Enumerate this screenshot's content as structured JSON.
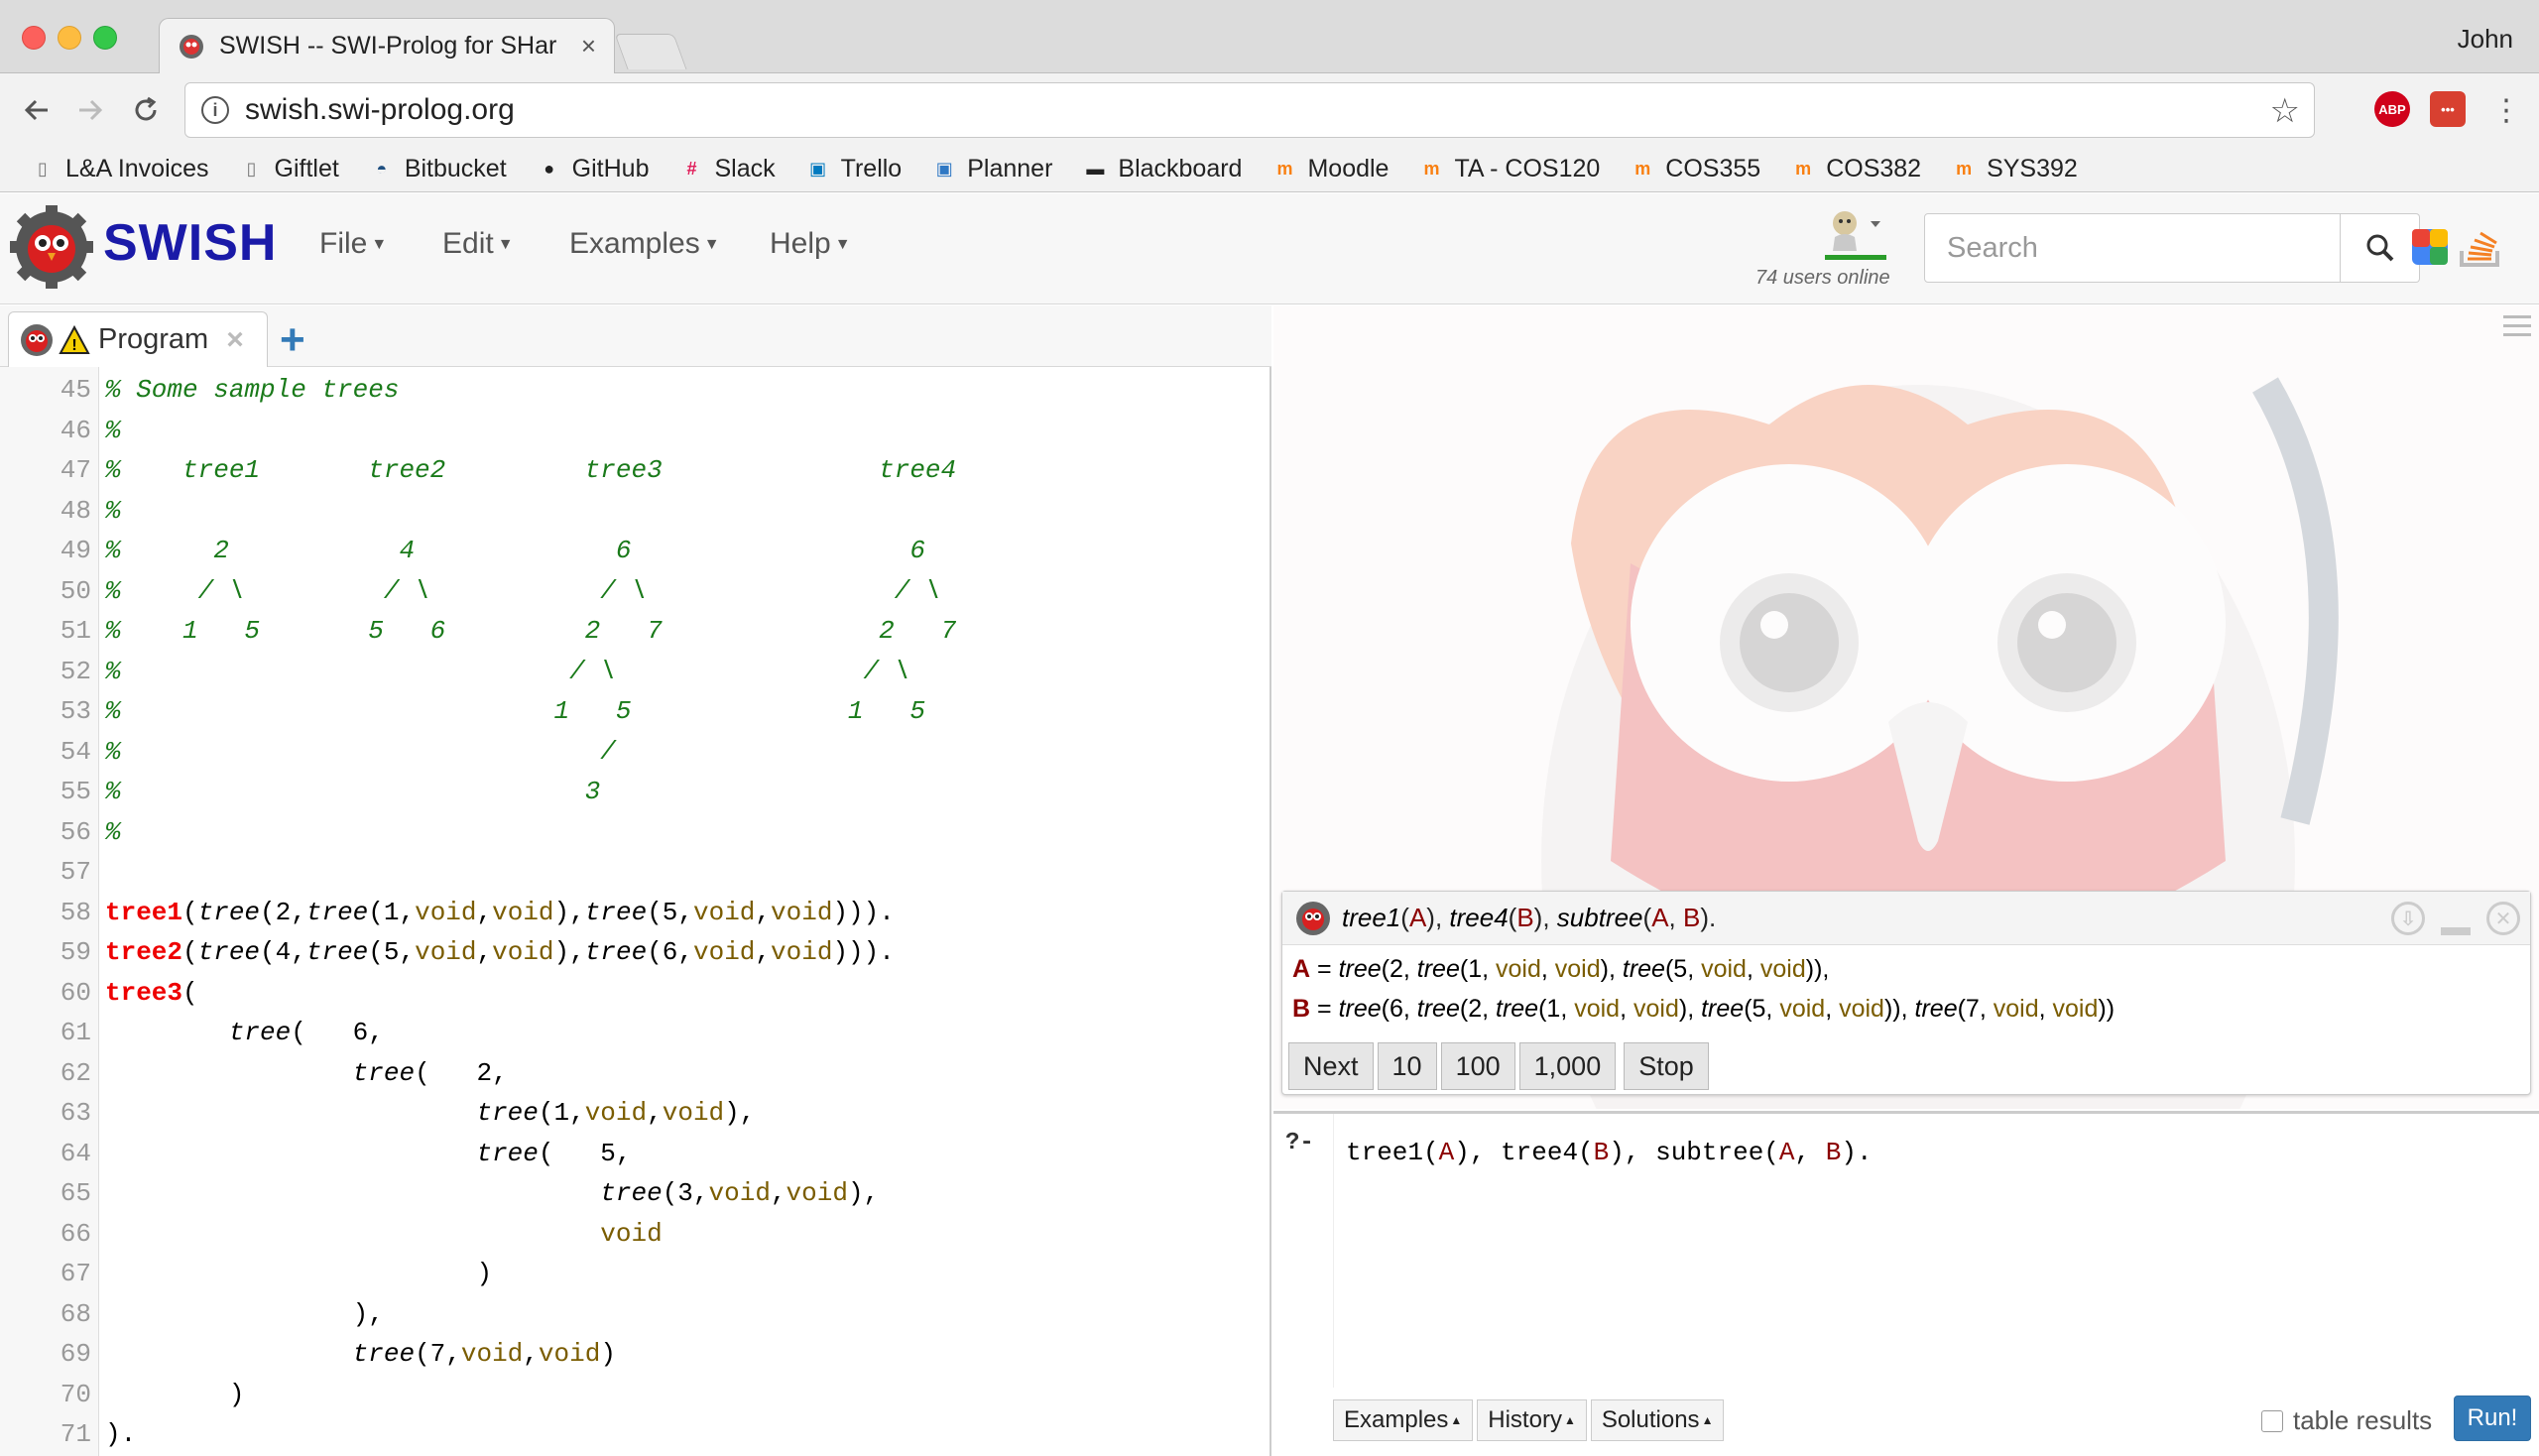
{
  "browser": {
    "tab_title": "SWISH -- SWI-Prolog for SHar",
    "tab_close": "×",
    "profile": "John",
    "url": "swish.swi-prolog.org",
    "ext1_label": "ABP",
    "ext2_label": "•••",
    "colors": {
      "close": "#fc605c",
      "minimize": "#fdbc40",
      "maximize": "#34c84a"
    }
  },
  "bookmarks": [
    {
      "label": "L&A Invoices",
      "icon": "page-icon"
    },
    {
      "label": "Giftlet",
      "icon": "page-icon"
    },
    {
      "label": "Bitbucket",
      "icon": "bitbucket-icon"
    },
    {
      "label": "GitHub",
      "icon": "github-icon"
    },
    {
      "label": "Slack",
      "icon": "slack-icon"
    },
    {
      "label": "Trello",
      "icon": "trello-icon"
    },
    {
      "label": "Planner",
      "icon": "planner-icon"
    },
    {
      "label": "Blackboard",
      "icon": "blackboard-icon"
    },
    {
      "label": "Moodle",
      "icon": "moodle-icon"
    },
    {
      "label": "TA -  COS120",
      "icon": "moodle-icon"
    },
    {
      "label": "COS355",
      "icon": "moodle-icon"
    },
    {
      "label": "COS382",
      "icon": "moodle-icon"
    },
    {
      "label": "SYS392",
      "icon": "moodle-icon"
    }
  ],
  "header": {
    "brand": "SWISH",
    "menus": [
      "File",
      "Edit",
      "Examples",
      "Help"
    ],
    "users_online": "74 users online",
    "search_placeholder": "Search"
  },
  "program_tab": {
    "label": "Program",
    "close": "×",
    "add": "+"
  },
  "editor": {
    "lines": [
      {
        "n": "45",
        "t": [
          [
            "cm-comment",
            "% Some sample trees"
          ]
        ]
      },
      {
        "n": "46",
        "t": [
          [
            "cm-comment",
            "%"
          ]
        ]
      },
      {
        "n": "47",
        "t": [
          [
            "cm-comment",
            "%    tree1       tree2         tree3              tree4"
          ]
        ]
      },
      {
        "n": "48",
        "t": [
          [
            "cm-comment",
            "%"
          ]
        ]
      },
      {
        "n": "49",
        "t": [
          [
            "cm-comment",
            "%      2           4             6                  6"
          ]
        ]
      },
      {
        "n": "50",
        "t": [
          [
            "cm-comment",
            "%     / \\         / \\           / \\                / \\"
          ]
        ]
      },
      {
        "n": "51",
        "t": [
          [
            "cm-comment",
            "%    1   5       5   6         2   7              2   7"
          ]
        ]
      },
      {
        "n": "52",
        "t": [
          [
            "cm-comment",
            "%                             / \\                / \\"
          ]
        ]
      },
      {
        "n": "53",
        "t": [
          [
            "cm-comment",
            "%                            1   5              1   5"
          ]
        ]
      },
      {
        "n": "54",
        "t": [
          [
            "cm-comment",
            "%                               /"
          ]
        ]
      },
      {
        "n": "55",
        "t": [
          [
            "cm-comment",
            "%                              3"
          ]
        ]
      },
      {
        "n": "56",
        "t": [
          [
            "cm-comment",
            "%"
          ]
        ]
      },
      {
        "n": "57",
        "t": []
      },
      {
        "n": "58",
        "t": [
          [
            "cm-head",
            "tree1"
          ],
          [
            "cm-punct",
            "("
          ],
          [
            "cm-goal",
            "tree"
          ],
          [
            "cm-punct",
            "(2,"
          ],
          [
            "cm-goal",
            "tree"
          ],
          [
            "cm-punct",
            "(1,"
          ],
          [
            "cm-atom",
            "void"
          ],
          [
            "cm-punct",
            ","
          ],
          [
            "cm-atom",
            "void"
          ],
          [
            "cm-punct",
            "),"
          ],
          [
            "cm-goal",
            "tree"
          ],
          [
            "cm-punct",
            "(5,"
          ],
          [
            "cm-atom",
            "void"
          ],
          [
            "cm-punct",
            ","
          ],
          [
            "cm-atom",
            "void"
          ],
          [
            "cm-punct",
            ")))."
          ]
        ]
      },
      {
        "n": "59",
        "t": [
          [
            "cm-head",
            "tree2"
          ],
          [
            "cm-punct",
            "("
          ],
          [
            "cm-goal",
            "tree"
          ],
          [
            "cm-punct",
            "(4,"
          ],
          [
            "cm-goal",
            "tree"
          ],
          [
            "cm-punct",
            "(5,"
          ],
          [
            "cm-atom",
            "void"
          ],
          [
            "cm-punct",
            ","
          ],
          [
            "cm-atom",
            "void"
          ],
          [
            "cm-punct",
            "),"
          ],
          [
            "cm-goal",
            "tree"
          ],
          [
            "cm-punct",
            "(6,"
          ],
          [
            "cm-atom",
            "void"
          ],
          [
            "cm-punct",
            ","
          ],
          [
            "cm-atom",
            "void"
          ],
          [
            "cm-punct",
            ")))."
          ]
        ]
      },
      {
        "n": "60",
        "t": [
          [
            "cm-head",
            "tree3"
          ],
          [
            "cm-punct",
            "("
          ]
        ]
      },
      {
        "n": "61",
        "t": [
          [
            "cm-punct",
            "        "
          ],
          [
            "cm-goal",
            "tree"
          ],
          [
            "cm-punct",
            "(   6,"
          ]
        ]
      },
      {
        "n": "62",
        "t": [
          [
            "cm-punct",
            "                "
          ],
          [
            "cm-goal",
            "tree"
          ],
          [
            "cm-punct",
            "(   2,"
          ]
        ]
      },
      {
        "n": "63",
        "t": [
          [
            "cm-punct",
            "                        "
          ],
          [
            "cm-goal",
            "tree"
          ],
          [
            "cm-punct",
            "(1,"
          ],
          [
            "cm-atom",
            "void"
          ],
          [
            "cm-punct",
            ","
          ],
          [
            "cm-atom",
            "void"
          ],
          [
            "cm-punct",
            "),"
          ]
        ]
      },
      {
        "n": "64",
        "t": [
          [
            "cm-punct",
            "                        "
          ],
          [
            "cm-goal",
            "tree"
          ],
          [
            "cm-punct",
            "(   5,"
          ]
        ]
      },
      {
        "n": "65",
        "t": [
          [
            "cm-punct",
            "                                "
          ],
          [
            "cm-goal",
            "tree"
          ],
          [
            "cm-punct",
            "(3,"
          ],
          [
            "cm-atom",
            "void"
          ],
          [
            "cm-punct",
            ","
          ],
          [
            "cm-atom",
            "void"
          ],
          [
            "cm-punct",
            "),"
          ]
        ]
      },
      {
        "n": "66",
        "t": [
          [
            "cm-punct",
            "                                "
          ],
          [
            "cm-atom",
            "void"
          ]
        ]
      },
      {
        "n": "67",
        "t": [
          [
            "cm-punct",
            "                        )"
          ]
        ]
      },
      {
        "n": "68",
        "t": [
          [
            "cm-punct",
            "                ),"
          ]
        ]
      },
      {
        "n": "69",
        "t": [
          [
            "cm-punct",
            "                "
          ],
          [
            "cm-goal",
            "tree"
          ],
          [
            "cm-punct",
            "(7,"
          ],
          [
            "cm-atom",
            "void"
          ],
          [
            "cm-punct",
            ","
          ],
          [
            "cm-atom",
            "void"
          ],
          [
            "cm-punct",
            ")"
          ]
        ]
      },
      {
        "n": "70",
        "t": [
          [
            "cm-punct",
            "        )"
          ]
        ]
      },
      {
        "n": "71",
        "t": [
          [
            "cm-punct",
            ")."
          ]
        ]
      }
    ]
  },
  "answer": {
    "query": [
      [
        "q-goal",
        "tree1"
      ],
      [
        "",
        "("
      ],
      [
        "q-var",
        "A"
      ],
      [
        "",
        "), "
      ],
      [
        "q-goal",
        "tree4"
      ],
      [
        "",
        "("
      ],
      [
        "q-var",
        "B"
      ],
      [
        "",
        "), "
      ],
      [
        "q-goal",
        "subtree"
      ],
      [
        "",
        "("
      ],
      [
        "q-var",
        "A"
      ],
      [
        "",
        ", "
      ],
      [
        "q-var",
        "B"
      ],
      [
        "",
        ")."
      ]
    ],
    "bindings": [
      [
        [
          "bind-var",
          "A"
        ],
        [
          "",
          " = "
        ],
        [
          "it",
          "tree"
        ],
        [
          "",
          "(2, "
        ],
        [
          "it",
          "tree"
        ],
        [
          "",
          "(1, "
        ],
        [
          "bind-atom",
          "void"
        ],
        [
          "",
          ", "
        ],
        [
          "bind-atom",
          "void"
        ],
        [
          "",
          "), "
        ],
        [
          "it",
          "tree"
        ],
        [
          "",
          "(5, "
        ],
        [
          "bind-atom",
          "void"
        ],
        [
          "",
          ", "
        ],
        [
          "bind-atom",
          "void"
        ],
        [
          "",
          ")),"
        ]
      ],
      [
        [
          "bind-var",
          "B"
        ],
        [
          "",
          " = "
        ],
        [
          "it",
          "tree"
        ],
        [
          "",
          "(6, "
        ],
        [
          "it",
          "tree"
        ],
        [
          "",
          "(2, "
        ],
        [
          "it",
          "tree"
        ],
        [
          "",
          "(1, "
        ],
        [
          "bind-atom",
          "void"
        ],
        [
          "",
          ", "
        ],
        [
          "bind-atom",
          "void"
        ],
        [
          "",
          "), "
        ],
        [
          "it",
          "tree"
        ],
        [
          "",
          "(5, "
        ],
        [
          "bind-atom",
          "void"
        ],
        [
          "",
          ", "
        ],
        [
          "bind-atom",
          "void"
        ],
        [
          "",
          ")), "
        ],
        [
          "it",
          "tree"
        ],
        [
          "",
          "(7, "
        ],
        [
          "bind-atom",
          "void"
        ],
        [
          "",
          ", "
        ],
        [
          "bind-atom",
          "void"
        ],
        [
          "",
          "))"
        ]
      ]
    ],
    "buttons": [
      "Next",
      "10",
      "100",
      "1,000"
    ],
    "stop": "Stop"
  },
  "query": {
    "prompt": "?-",
    "text": [
      [
        "cm-punct",
        "tree1("
      ],
      [
        "q-var",
        "A"
      ],
      [
        "cm-punct",
        "), tree4("
      ],
      [
        "q-var",
        "B"
      ],
      [
        "cm-punct",
        "), subtree("
      ],
      [
        "q-var",
        "A"
      ],
      [
        "cm-punct",
        ", "
      ],
      [
        "q-var",
        "B"
      ],
      [
        "cm-punct",
        ")."
      ]
    ],
    "buttons": [
      "Examples",
      "History",
      "Solutions"
    ],
    "table_results": "table results",
    "run": "Run!"
  }
}
